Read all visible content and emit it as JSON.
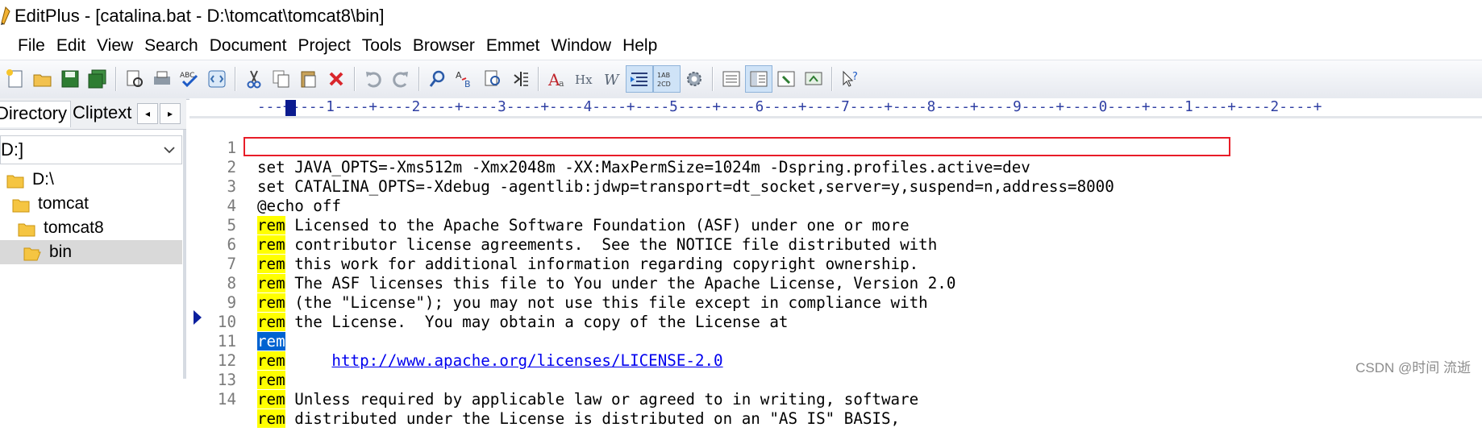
{
  "window": {
    "title": "EditPlus - [catalina.bat - D:\\tomcat\\tomcat8\\bin]"
  },
  "menu": [
    "File",
    "Edit",
    "View",
    "Search",
    "Document",
    "Project",
    "Tools",
    "Browser",
    "Emmet",
    "Window",
    "Help"
  ],
  "toolbar": {
    "buttons": [
      {
        "name": "new-file-icon"
      },
      {
        "name": "open-folder-icon"
      },
      {
        "name": "save-icon"
      },
      {
        "name": "save-all-icon"
      },
      {
        "name": "print-preview-icon"
      },
      {
        "name": "print-icon"
      },
      {
        "name": "spell-check-icon"
      },
      {
        "name": "browser-preview-icon"
      },
      {
        "name": "cut-icon"
      },
      {
        "name": "copy-icon"
      },
      {
        "name": "paste-icon"
      },
      {
        "name": "delete-icon"
      },
      {
        "name": "undo-icon"
      },
      {
        "name": "redo-icon"
      },
      {
        "name": "find-icon"
      },
      {
        "name": "replace-icon"
      },
      {
        "name": "find-in-files-icon"
      },
      {
        "name": "goto-line-icon"
      },
      {
        "name": "font-icon"
      },
      {
        "name": "hex-viewer-icon"
      },
      {
        "name": "word-wrap-icon"
      },
      {
        "name": "indent-icon"
      },
      {
        "name": "spell-settings-icon"
      },
      {
        "name": "settings-gear-icon"
      },
      {
        "name": "output-window-icon"
      },
      {
        "name": "directory-window-icon"
      },
      {
        "name": "cliptext-icon"
      },
      {
        "name": "screen-icon"
      },
      {
        "name": "help-icon"
      }
    ]
  },
  "sidebar": {
    "tabs": [
      "Directory",
      "Cliptext"
    ],
    "arrows": [
      "◂",
      "▸"
    ],
    "drive": "D:]",
    "tree": [
      {
        "label": "D:\\",
        "selected": false
      },
      {
        "label": "tomcat",
        "selected": false
      },
      {
        "label": "tomcat8",
        "selected": false
      },
      {
        "label": "bin",
        "selected": true
      }
    ]
  },
  "editor": {
    "ruler": "---+----1----+----2----+----3----+----4----+----5----+----6----+----7----+----8----+----9----+----0----+----1----+----2----+",
    "lines": [
      {
        "num": "1",
        "kw": "",
        "text": "set JAVA_OPTS=-Xms512m -Xmx2048m -XX:MaxPermSize=1024m -Dspring.profiles.active=dev"
      },
      {
        "num": "2",
        "kw": "",
        "text": "set CATALINA_OPTS=-Xdebug -agentlib:jdwp=transport=dt_socket,server=y,suspend=n,address=8000"
      },
      {
        "num": "3",
        "kw": "",
        "text": "@echo off"
      },
      {
        "num": "4",
        "kw": "rem",
        "text": " Licensed to the Apache Software Foundation (ASF) under one or more"
      },
      {
        "num": "5",
        "kw": "rem",
        "text": " contributor license agreements.  See the NOTICE file distributed with"
      },
      {
        "num": "6",
        "kw": "rem",
        "text": " this work for additional information regarding copyright ownership."
      },
      {
        "num": "7",
        "kw": "rem",
        "text": " The ASF licenses this file to You under the Apache License, Version 2.0"
      },
      {
        "num": "8",
        "kw": "rem",
        "text": " (the \"License\"); you may not use this file except in compliance with"
      },
      {
        "num": "9",
        "kw": "rem",
        "text": " the License.  You may obtain a copy of the License at"
      },
      {
        "num": "10",
        "kw": "rem",
        "text": ""
      },
      {
        "num": "11",
        "kw": "rem",
        "text": "     ",
        "link": "http://www.apache.org/licenses/LICENSE-2.0"
      },
      {
        "num": "12",
        "kw": "rem",
        "text": ""
      },
      {
        "num": "13",
        "kw": "rem",
        "text": " Unless required by applicable law or agreed to in writing, software"
      },
      {
        "num": "14",
        "kw": "rem",
        "text": " distributed under the License is distributed on an \"AS IS\" BASIS,"
      }
    ]
  },
  "watermark": "CSDN @时间 流逝",
  "colors": {
    "keyword_highlight": "#ffff00",
    "selection": "#0063d1",
    "annotation_box": "#e81d28",
    "link": "#0000ee"
  }
}
